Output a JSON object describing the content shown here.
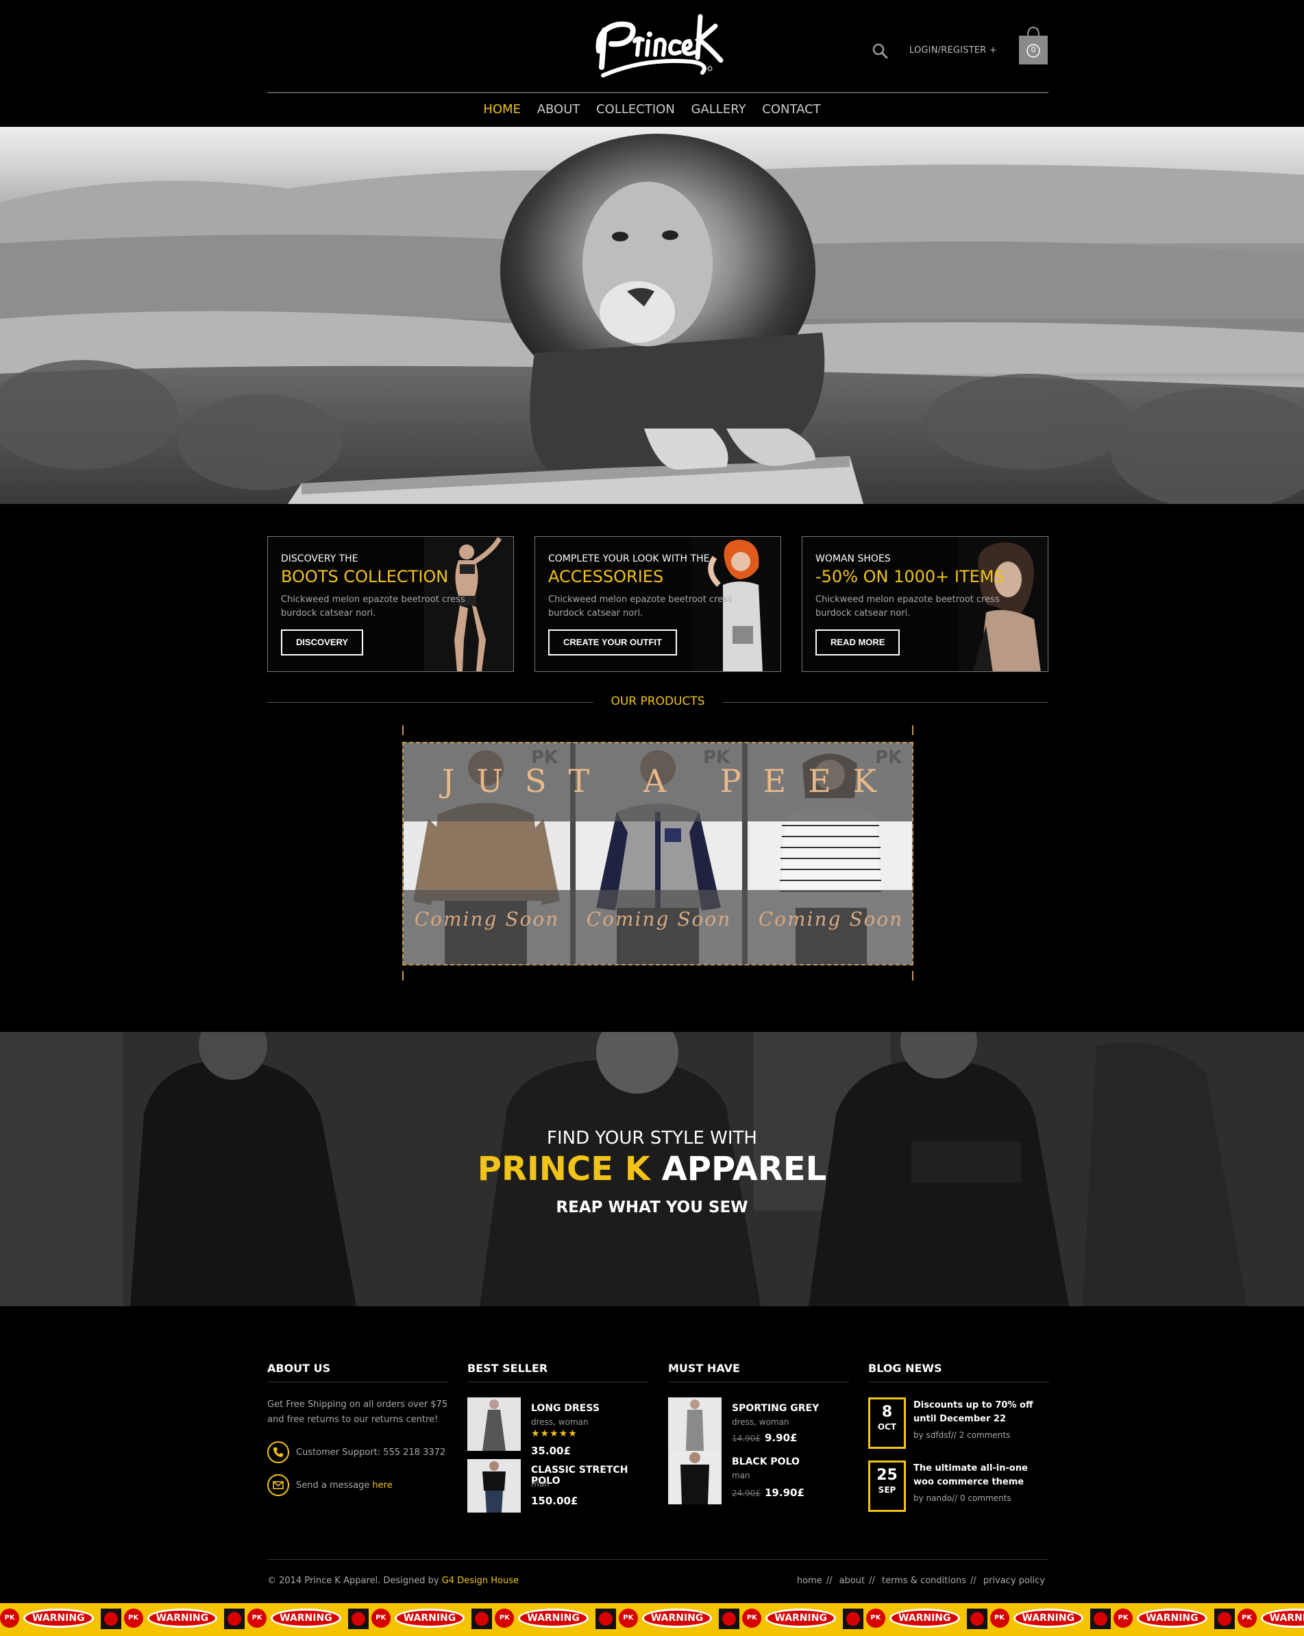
{
  "header": {
    "logo_alt": "Prince K",
    "login_label": "LOGIN/REGISTER +",
    "cart_count": "0"
  },
  "nav": {
    "items": [
      {
        "label": "HOME",
        "active": true
      },
      {
        "label": "ABOUT"
      },
      {
        "label": "COLLECTION"
      },
      {
        "label": "GALLERY"
      },
      {
        "label": "CONTACT"
      }
    ]
  },
  "promos": [
    {
      "kicker": "DISCOVERY THE",
      "title": "BOOTS COLLECTION",
      "text": "Chickweed melon epazote beetroot cress burdock catsear nori.",
      "button": "DISCOVERY"
    },
    {
      "kicker": "COMPLETE YOUR LOOK WITH THE",
      "title": "ACCESSORIES",
      "text": "Chickweed melon epazote beetroot cress burdock catsear nori.",
      "button": "CREATE YOUR OUTFIT"
    },
    {
      "kicker": "WOMAN SHOES",
      "title": "-50% ON 1000+ ITEMS",
      "text": "Chickweed melon epazote beetroot cress burdock catsear nori.",
      "button": "READ MORE"
    }
  ],
  "products": {
    "heading": "OUR PRODUCTS",
    "peek_title": "JUST A PEEK",
    "coming": [
      "Coming Soon",
      "Coming Soon",
      "Coming Soon"
    ],
    "pk_marks": [
      "PK",
      "PK",
      "PK"
    ]
  },
  "banner": {
    "sub": "FIND YOUR STYLE WITH",
    "title_yellow": "PRINCE K",
    "title_white": "APPAREL",
    "tagline": "REAP WHAT YOU SEW"
  },
  "footer": {
    "about": {
      "heading": "ABOUT US",
      "text": "Get Free Shipping on all orders over $75 and free returns to our returns centre!",
      "support": "Customer Support: 555 218 3372",
      "message": "Send a message",
      "message_link": "here"
    },
    "best_seller": {
      "heading": "BEST SELLER",
      "items": [
        {
          "name": "LONG DRESS",
          "cat": "dress, woman",
          "stars": "★★★★★",
          "price": "35.00£"
        },
        {
          "name": "CLASSIC STRETCH POLO",
          "cat": "man",
          "price": "150.00£"
        }
      ]
    },
    "must_have": {
      "heading": "MUST HAVE",
      "items": [
        {
          "name": "SPORTING GREY",
          "cat": "dress, woman",
          "old": "14.90£",
          "price": "9.90£"
        },
        {
          "name": "BLACK POLO",
          "cat": "man",
          "old": "24.90£",
          "price": "19.90£"
        }
      ]
    },
    "blog": {
      "heading": "BLOG NEWS",
      "items": [
        {
          "day": "8",
          "mon": "OCT",
          "title": "Discounts up to 70% off until December 22",
          "meta": "by sdfdsf// 2 comments"
        },
        {
          "day": "25",
          "mon": "SEP",
          "title": "The ultimate all-in-one woo commerce theme",
          "meta": "by nando// 0 comments"
        }
      ]
    },
    "copyright": "© 2014 Prince K Apparel. Designed by",
    "designer": "G4 Design House",
    "links": [
      "home",
      "about",
      "terms & conditions",
      "privacy policy"
    ]
  },
  "tape": {
    "warning": "WARNING",
    "pk": "PK"
  },
  "colors": {
    "accent": "#f2c318",
    "background": "#000000",
    "peek_text": "#e9b98a"
  }
}
